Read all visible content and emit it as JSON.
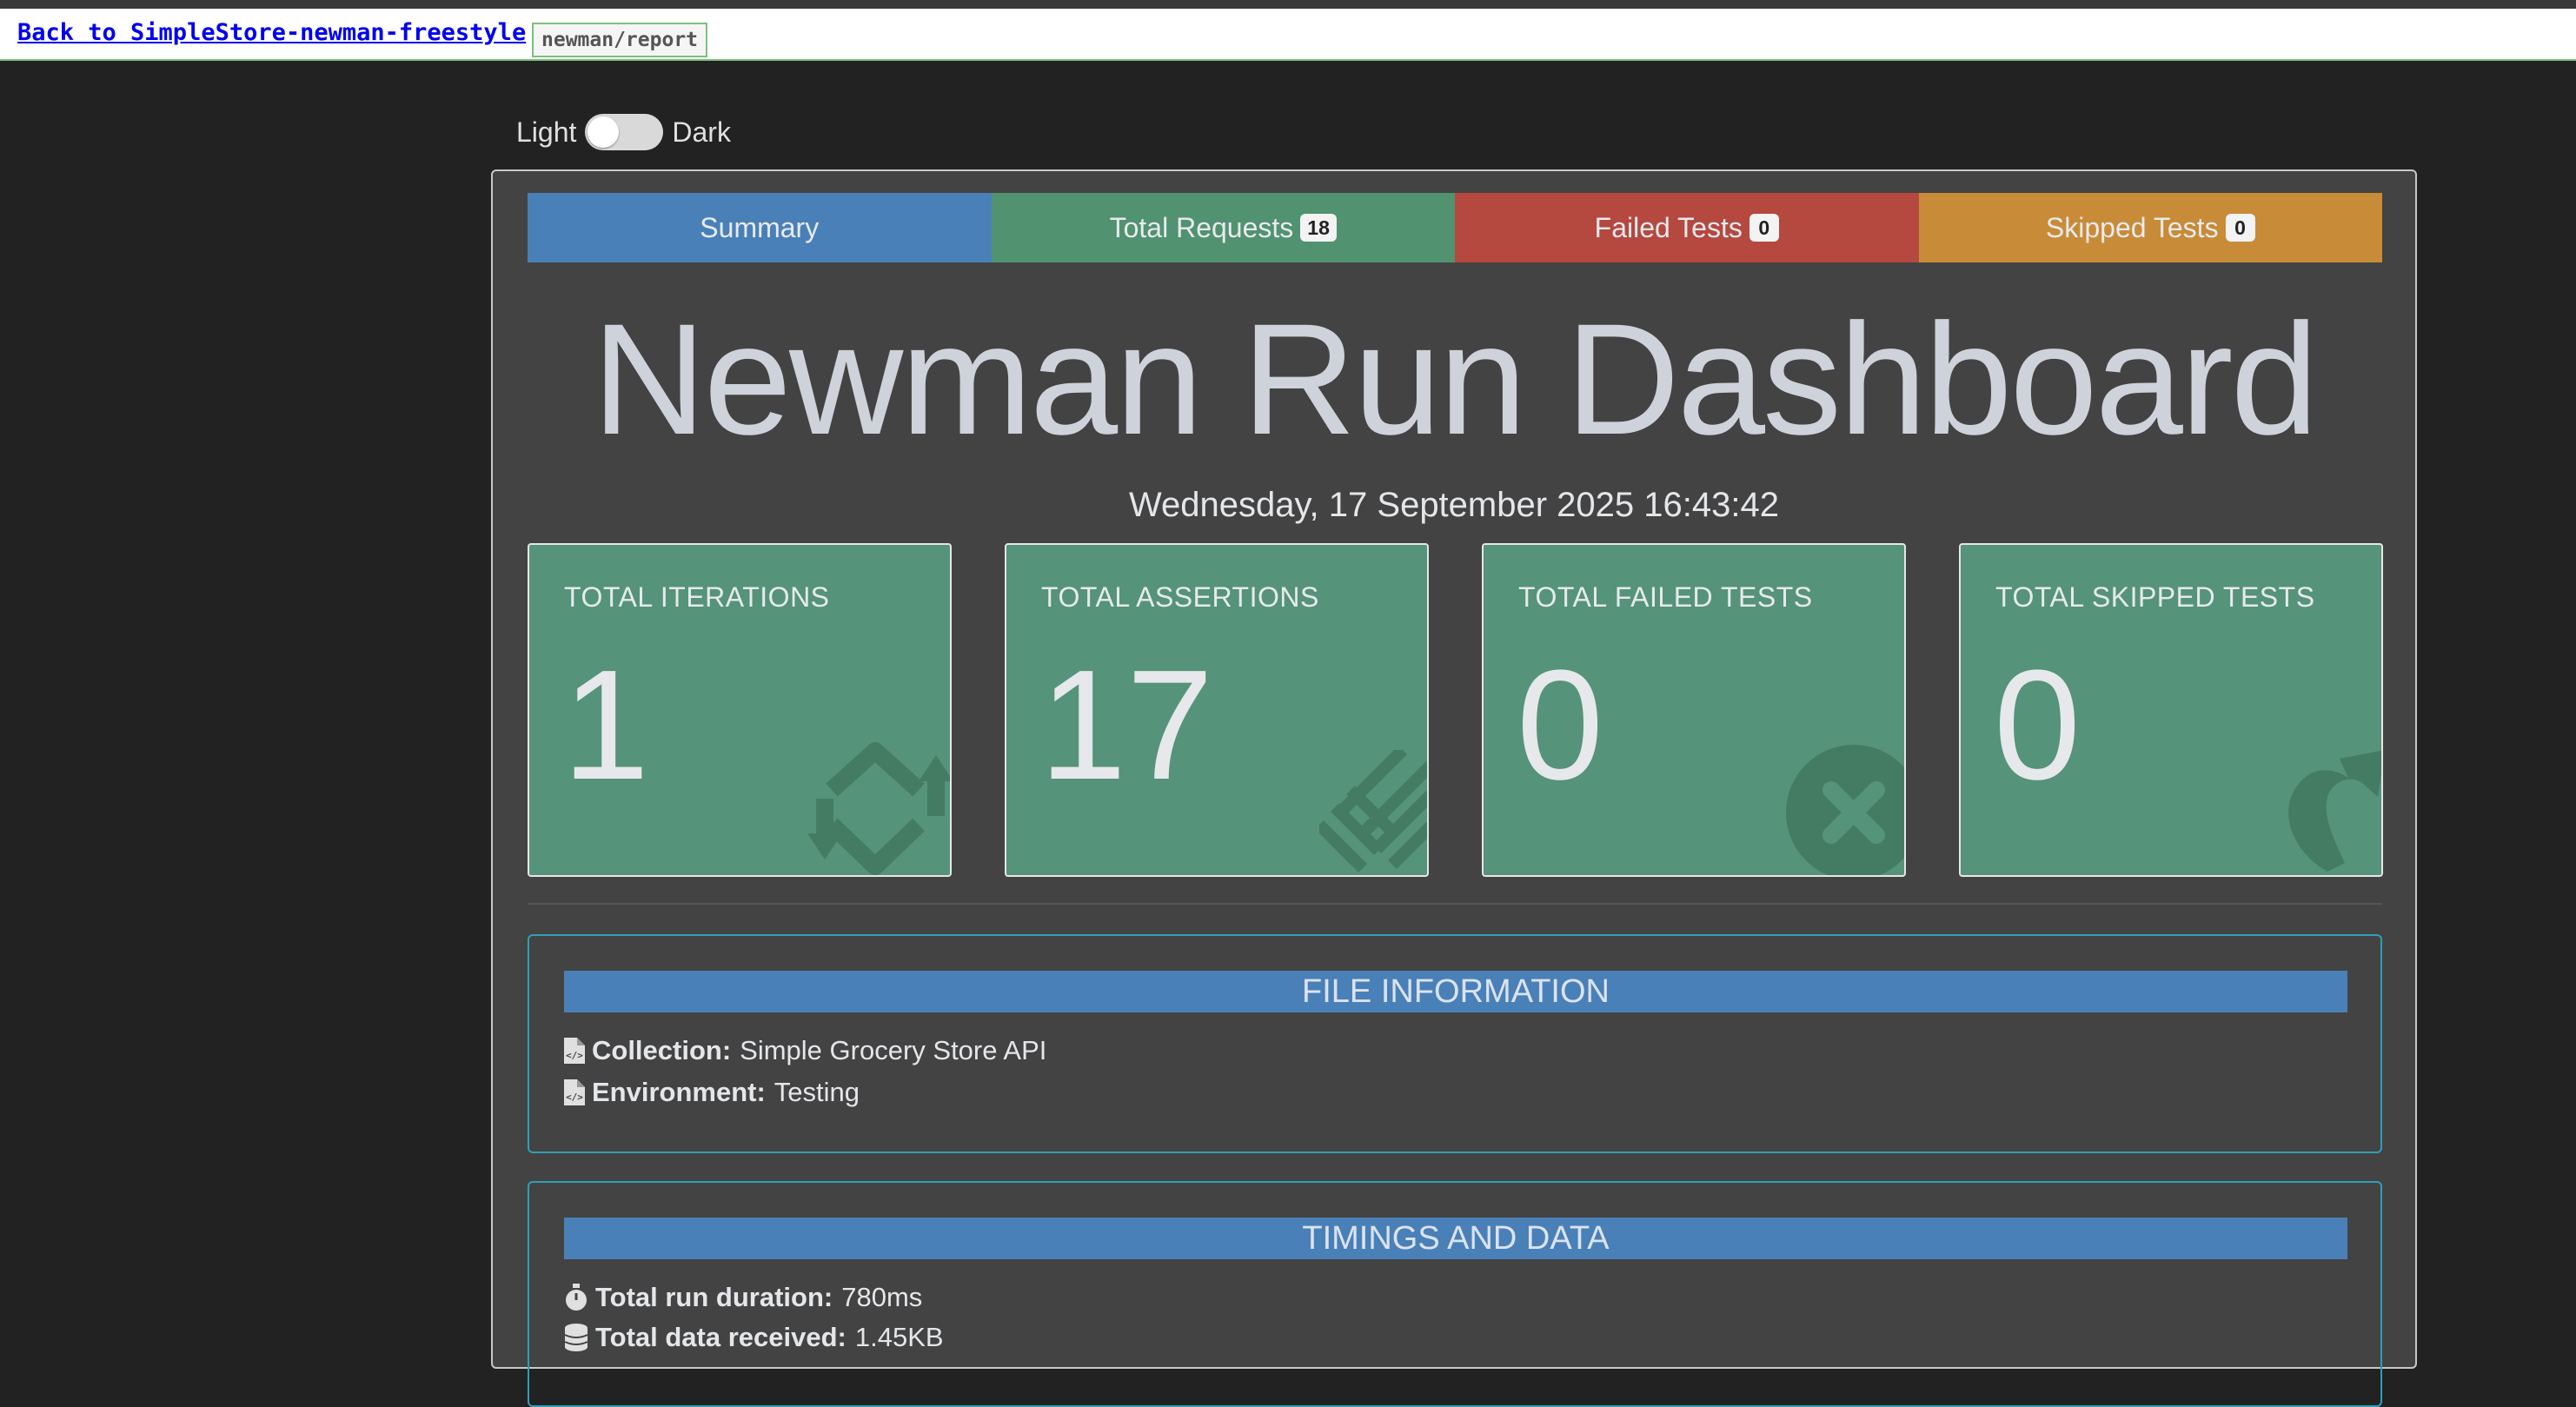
{
  "topbar": {
    "back_link": "Back to SimpleStore-newman-freestyle",
    "report_tab": "newman/report"
  },
  "theme": {
    "light_label": "Light",
    "dark_label": "Dark"
  },
  "tabs": [
    {
      "label": "Summary",
      "badge": ""
    },
    {
      "label": "Total Requests",
      "badge": "18"
    },
    {
      "label": "Failed Tests",
      "badge": "0"
    },
    {
      "label": "Skipped Tests",
      "badge": "0"
    }
  ],
  "title": "Newman Run Dashboard",
  "date": "Wednesday, 17 September 2025 16:43:42",
  "cards": [
    {
      "label": "TOTAL ITERATIONS",
      "value": "1",
      "icon": "sync-icon"
    },
    {
      "label": "TOTAL ASSERTIONS",
      "value": "17",
      "icon": "tasks-icon"
    },
    {
      "label": "TOTAL FAILED TESTS",
      "value": "0",
      "icon": "times-circle-icon"
    },
    {
      "label": "TOTAL SKIPPED TESTS",
      "value": "0",
      "icon": "share-icon"
    }
  ],
  "file_info": {
    "heading": "FILE INFORMATION",
    "collection_label": "Collection:",
    "collection_value": "Simple Grocery Store API",
    "environment_label": "Environment:",
    "environment_value": "Testing"
  },
  "timings": {
    "heading": "TIMINGS AND DATA",
    "duration_label": "Total run duration:",
    "duration_value": "780ms",
    "data_label": "Total data received:",
    "data_value": "1.45KB"
  },
  "colors": {
    "summary": "#4a80b8",
    "requests": "#519270",
    "failed": "#b5483f",
    "skipped": "#c88b37",
    "card": "#55937a",
    "panel": "#434343"
  }
}
